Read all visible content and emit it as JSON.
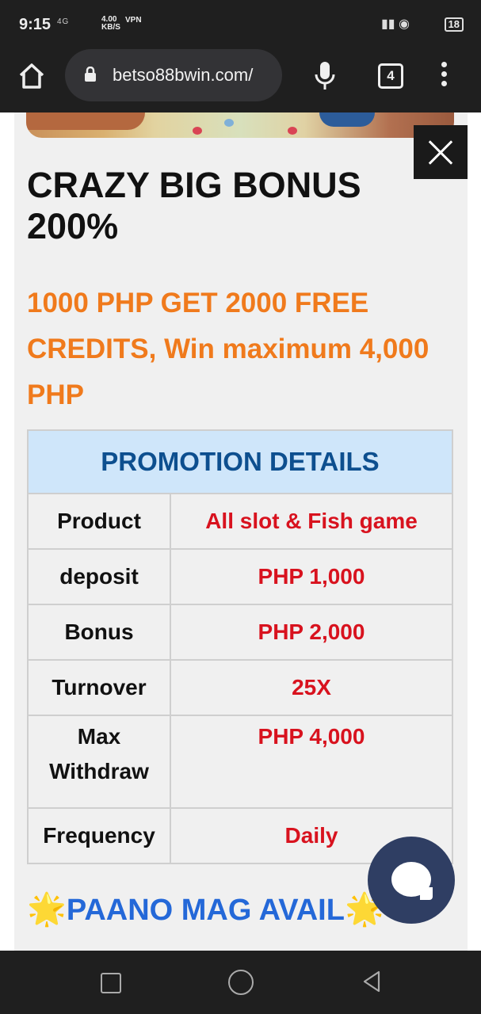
{
  "status_bar": {
    "time": "9:15",
    "network": "4G",
    "speed_value": "4.00",
    "speed_unit": "KB/S",
    "vpn": "VPN",
    "battery": "18"
  },
  "browser": {
    "url": "betso88bwin.com/",
    "tab_count": "4"
  },
  "promo": {
    "title": "CRAZY BIG BONUS 200%",
    "subtitle": "1000 PHP GET 2000 FREE CREDITS, Win maximum 4,000 PHP",
    "table_header": "PROMOTION DETAILS",
    "rows": [
      {
        "label": "Product",
        "value": "All slot & Fish game"
      },
      {
        "label": "deposit",
        "value": "PHP 1,000"
      },
      {
        "label": "Bonus",
        "value": "PHP 2,000"
      },
      {
        "label": "Turnover",
        "value": "25X"
      },
      {
        "label": "Max Withdraw",
        "value": "PHP 4,000"
      },
      {
        "label": "Frequency",
        "value": "Daily"
      }
    ],
    "avail_heading": "PAANO MAG AVAIL",
    "avail_emoji": "🌟"
  },
  "colors": {
    "subtitle": "#f07a1c",
    "table_header_bg": "#cfe6fa",
    "table_header_text": "#0d4f8f",
    "value_text": "#d8121e",
    "avail_text": "#2468d8",
    "chat_button": "#2f3e63"
  },
  "icons": {
    "home": "home-icon",
    "lock": "lock-icon",
    "mic": "microphone-icon",
    "menu": "more-vertical-icon",
    "close": "close-icon",
    "chat": "chat-icon"
  }
}
